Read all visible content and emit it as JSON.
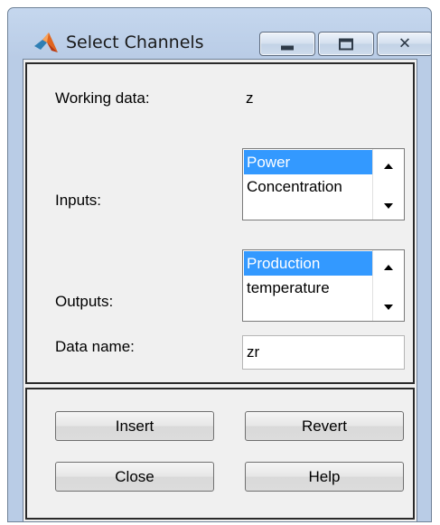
{
  "window": {
    "title": "Select Channels"
  },
  "titlebar": {
    "min_icon": "minimize-icon",
    "max_icon": "maximize-icon",
    "close_icon": "close-icon"
  },
  "form": {
    "working_data_label": "Working data:",
    "working_data_value": "z",
    "inputs_label": "Inputs:",
    "inputs_items": [
      "Power",
      "Concentration"
    ],
    "inputs_selected": "Power",
    "outputs_label": "Outputs:",
    "outputs_items": [
      "Production",
      "temperature"
    ],
    "outputs_selected": "Production",
    "data_name_label": "Data name:",
    "data_name_value": "zr"
  },
  "buttons": {
    "insert": "Insert",
    "revert": "Revert",
    "close": "Close",
    "help": "Help"
  },
  "colors": {
    "selection": "#3399ff",
    "frame": "#b9cce6",
    "background": "#f0f0f0"
  }
}
